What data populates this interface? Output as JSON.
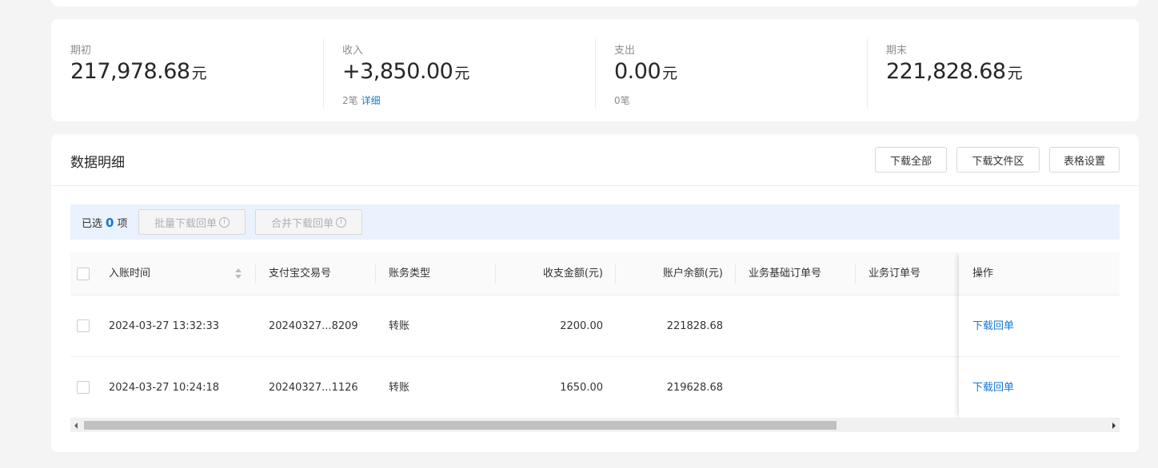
{
  "summary": {
    "opening": {
      "label": "期初",
      "value": "217,978.68",
      "unit": "元"
    },
    "income": {
      "label": "收入",
      "value": "+3,850.00",
      "unit": "元",
      "count": "2笔",
      "detail_link": "详细"
    },
    "expense": {
      "label": "支出",
      "value": "0.00",
      "unit": "元",
      "count": "0笔"
    },
    "closing": {
      "label": "期末",
      "value": "221,828.68",
      "unit": "元"
    }
  },
  "detail": {
    "title": "数据明细",
    "buttons": {
      "download_all": "下载全部",
      "download_area": "下载文件区",
      "table_settings": "表格设置"
    }
  },
  "selection": {
    "prefix": "已选",
    "count": "0",
    "suffix": "项",
    "batch_download": "批量下载回单",
    "merge_download": "合并下载回单"
  },
  "table": {
    "columns": {
      "time": "入账时间",
      "trade_no": "支付宝交易号",
      "type": "账务类型",
      "amount": "收支金额(元)",
      "balance": "账户余额(元)",
      "base_order": "业务基础订单号",
      "order": "业务订单号",
      "op": "操作"
    },
    "rows": [
      {
        "time": "2024-03-27 13:32:33",
        "trade_no": "20240327...8209",
        "type": "转账",
        "amount": "2200.00",
        "balance": "221828.68",
        "base_order": "",
        "order": "",
        "op": "下载回单"
      },
      {
        "time": "2024-03-27 10:24:18",
        "trade_no": "20240327...1126",
        "type": "转账",
        "amount": "1650.00",
        "balance": "219628.68",
        "base_order": "",
        "order": "",
        "op": "下载回单"
      }
    ]
  },
  "colors": {
    "accent": "#1677d2",
    "selection_bg": "#eaf2fd"
  }
}
